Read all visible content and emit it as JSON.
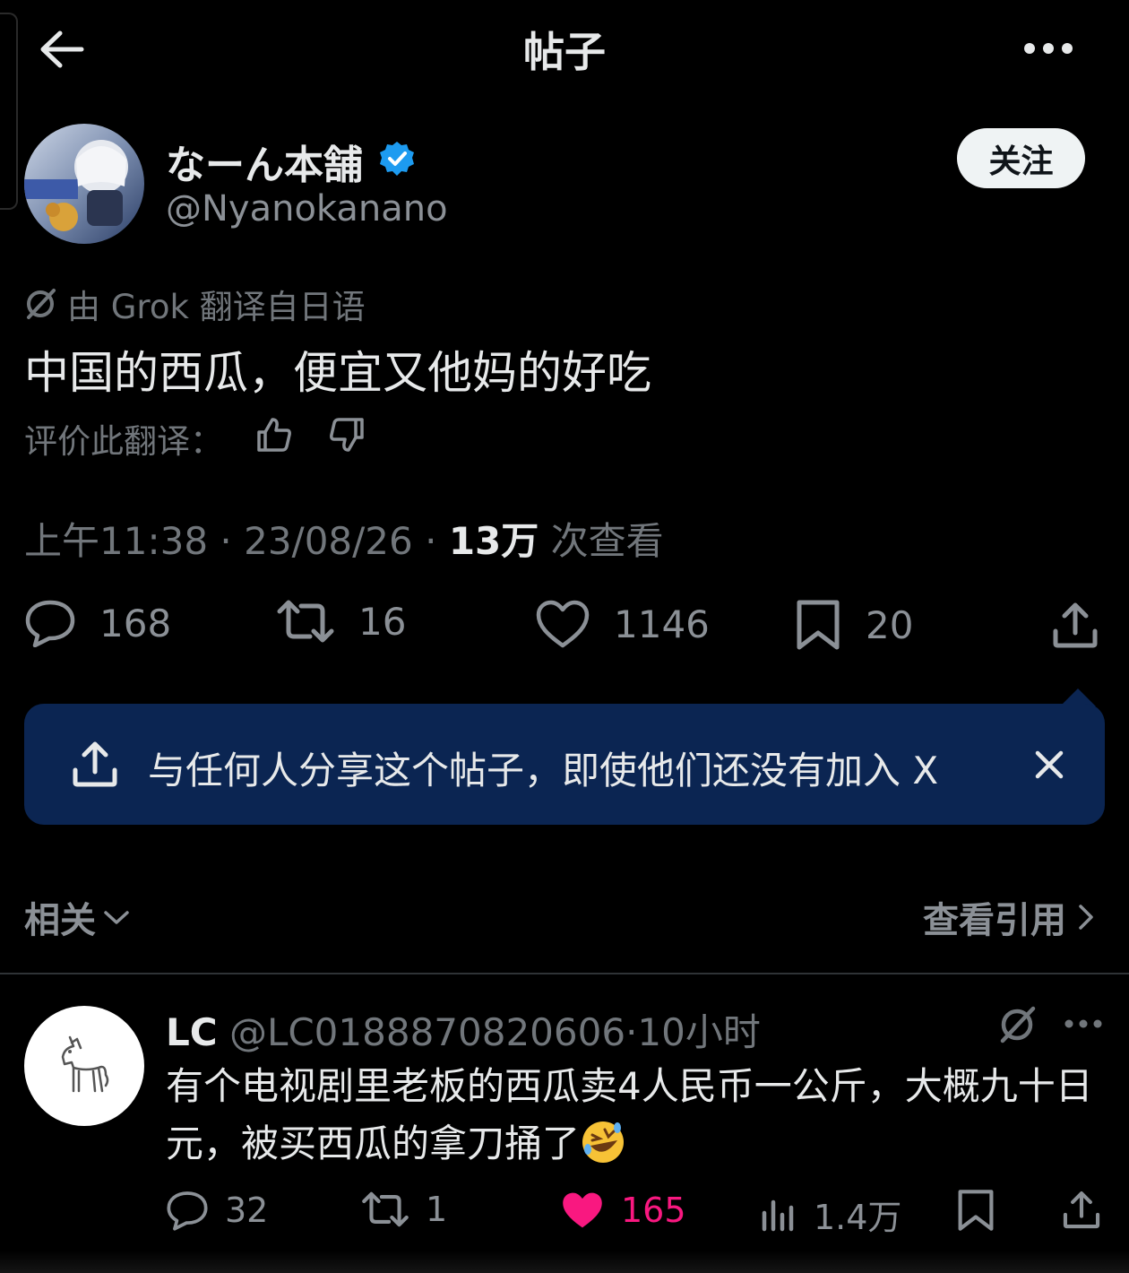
{
  "header": {
    "title": "帖子"
  },
  "author": {
    "name": "なーん本舗",
    "handle": "@Nyanokanano",
    "follow_label": "关注"
  },
  "translation": {
    "source_note": "由 Grok 翻译自日语",
    "text": "中国的西瓜，便宜又他妈的好吃",
    "rate_label": "评价此翻译："
  },
  "meta": {
    "time": "上午11:38",
    "date": "23/08/26",
    "views_count": "13万",
    "views_label": "次查看"
  },
  "actions": {
    "replies": "168",
    "reposts": "16",
    "likes": "1146",
    "bookmarks": "20"
  },
  "share_banner": {
    "text": "与任何人分享这个帖子，即使他们还没有加入 X"
  },
  "related": {
    "label": "相关",
    "view_quotes": "查看引用"
  },
  "reply": {
    "name": "LC",
    "handle": "@LC0188870820606",
    "time": "10小时",
    "text": "有个电视剧里老板的西瓜卖4人民币一公斤，大概九十日元，被买西瓜的拿刀捅了",
    "emoji": "rolling-on-floor-laughing",
    "actions": {
      "replies": "32",
      "reposts": "1",
      "likes": "165",
      "views": "1.4万"
    }
  },
  "colors": {
    "background": "#000000",
    "text_primary": "#e7e9ea",
    "text_secondary": "#71767b",
    "verified_badge": "#1d9bf0",
    "banner_bg": "#0b2552",
    "like_active": "#f91880"
  }
}
